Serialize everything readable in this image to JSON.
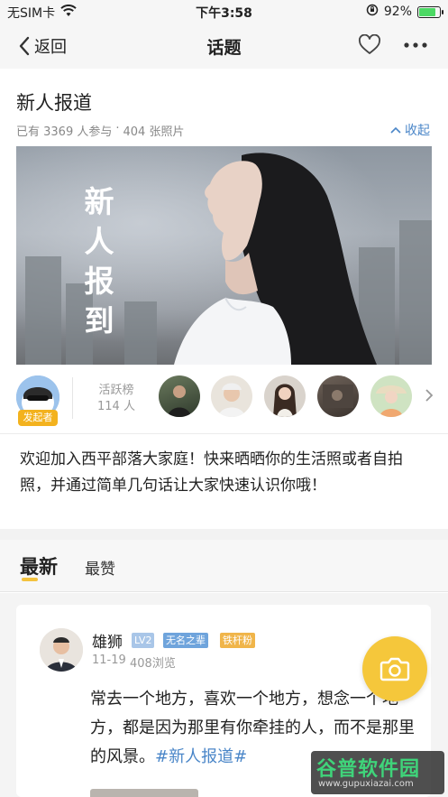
{
  "status_bar": {
    "carrier": "无SIM卡",
    "time": "下午3:58",
    "battery": "92%",
    "battery_level": 0.92
  },
  "nav": {
    "back_label": "返回",
    "title": "话题"
  },
  "topic": {
    "title": "新人报道",
    "participants": "已有 3369 人参与",
    "dot": "·",
    "photos": "404 张照片",
    "collapse_label": "收起",
    "banner_text": [
      "新",
      "人",
      "报",
      "到"
    ]
  },
  "participants_row": {
    "initiator_badge": "发起者",
    "active_board_label": "活跃榜",
    "active_board_count": "114 人"
  },
  "description": "欢迎加入西平部落大家庭！快来晒晒你的生活照或者自拍照，并通过简单几句话让大家快速认识你哦！",
  "tabs": {
    "latest": "最新",
    "likes": "最赞"
  },
  "post": {
    "author": "雄狮",
    "tags": [
      {
        "text": "LV2",
        "color": "#a9c6e8"
      },
      {
        "text": "无名之辈",
        "color": "#6fa4dc"
      },
      {
        "text": "铁杆粉",
        "color": "#f0b54a"
      }
    ],
    "date": "11-19",
    "views": "408浏览",
    "text": "常去一个地方，喜欢一个地方，想念一个地方，都是因为那里有你牵挂的人，而不是那里的风景。",
    "hashtag": "#新人报道#"
  },
  "watermark": {
    "main": "谷普软件园",
    "sub": "www.gupuxiazai.com"
  },
  "colors": {
    "accent_blue": "#4a86c8",
    "camera_yellow": "#f5c73b",
    "badge_orange": "#f3b21e"
  }
}
